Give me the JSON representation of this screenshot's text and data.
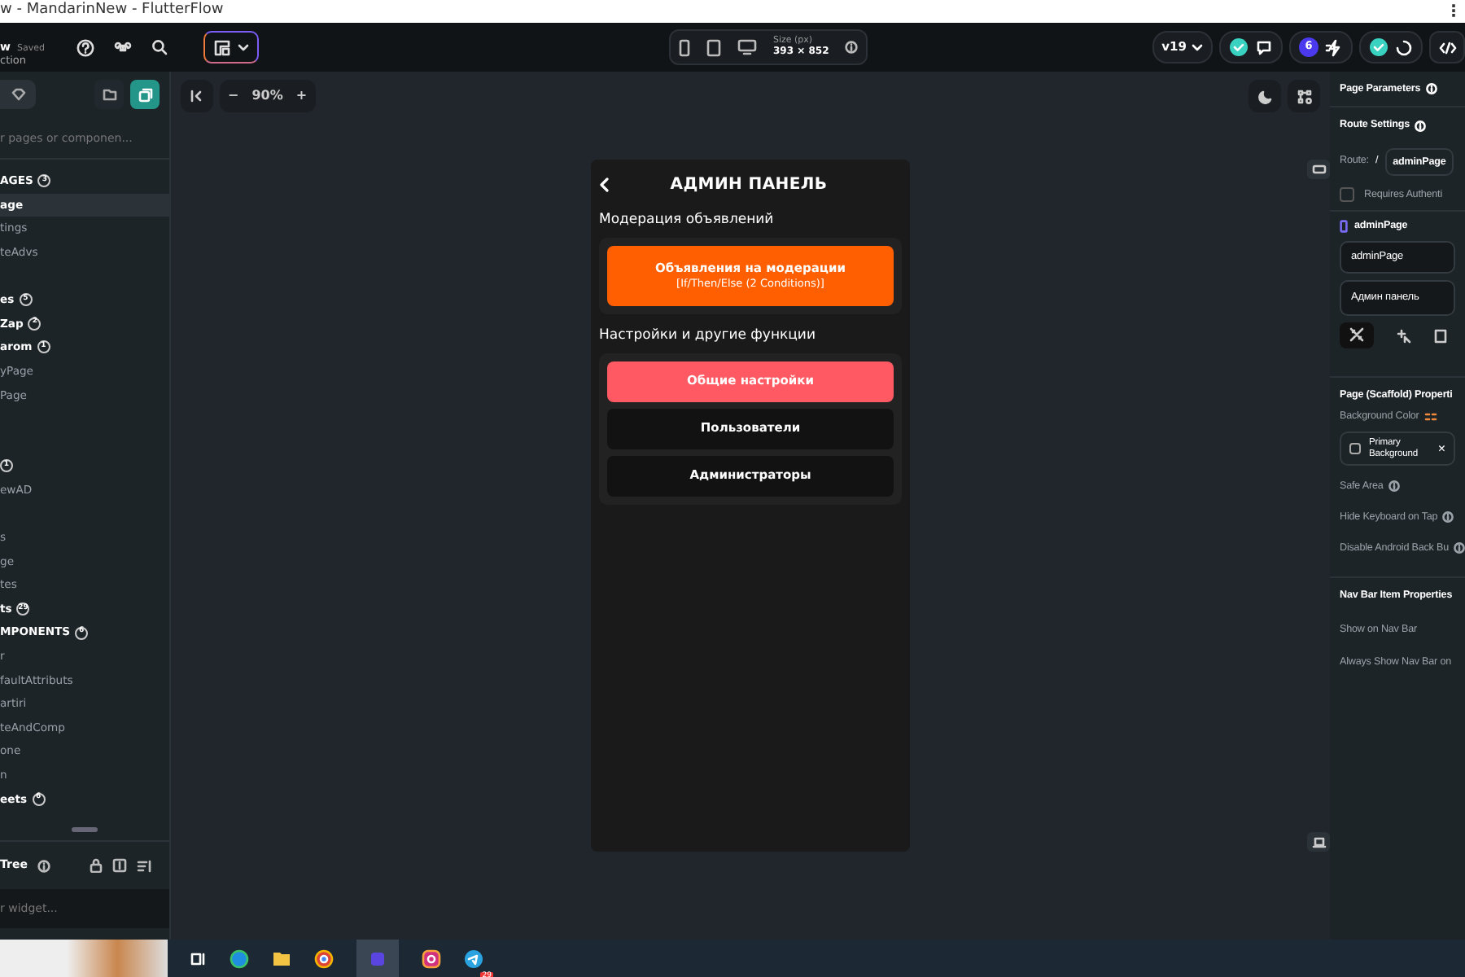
{
  "window": {
    "title": "w - MandarinNew - FlutterFlow",
    "menu": "⋮"
  },
  "toolbar": {
    "project_name": "w",
    "save_state": "Saved",
    "project_sub": "ction",
    "size_label": "Size (px)",
    "size_value": "393 × 852",
    "version": "v19",
    "notifications": "6"
  },
  "left_panel": {
    "search": {
      "placeholder": "r pages or componen..."
    },
    "items": [
      {
        "kind": "section",
        "label": "AGES",
        "count": "3"
      },
      {
        "kind": "page",
        "label": "age",
        "selected": true
      },
      {
        "kind": "page",
        "label": "tings",
        "selected": false
      },
      {
        "kind": "page",
        "label": "teAdvs",
        "selected": false
      },
      {
        "kind": "spacer"
      },
      {
        "kind": "folder",
        "label": "es",
        "count": "5"
      },
      {
        "kind": "folder",
        "label": "Zap",
        "count": "2"
      },
      {
        "kind": "folder",
        "label": "arom",
        "count": "1"
      },
      {
        "kind": "page",
        "label": "yPage",
        "selected": false
      },
      {
        "kind": "page",
        "label": "Page",
        "selected": false
      },
      {
        "kind": "spacer"
      },
      {
        "kind": "spacer"
      },
      {
        "kind": "folder",
        "count": "1"
      },
      {
        "kind": "page",
        "label": "ewAD",
        "selected": false
      },
      {
        "kind": "spacer"
      },
      {
        "kind": "page",
        "label": "s",
        "selected": false
      },
      {
        "kind": "page",
        "label": "ge",
        "selected": false
      },
      {
        "kind": "page",
        "label": "tes",
        "selected": false
      },
      {
        "kind": "folder",
        "label": "ts",
        "count": "29"
      },
      {
        "kind": "section",
        "label": "MPONENTS",
        "count": "6"
      },
      {
        "kind": "page",
        "label": "r",
        "selected": false
      },
      {
        "kind": "page",
        "label": "faultAttributs",
        "selected": false
      },
      {
        "kind": "page",
        "label": "artiri",
        "selected": false
      },
      {
        "kind": "page",
        "label": "teAndComp",
        "selected": false
      },
      {
        "kind": "page",
        "label": "one",
        "selected": false
      },
      {
        "kind": "page",
        "label": "n",
        "selected": false
      },
      {
        "kind": "folder",
        "label": "eets",
        "count": "6"
      }
    ],
    "tree_title": "Tree",
    "tree_search": {
      "placeholder": "r widget..."
    }
  },
  "canvas": {
    "zoom": "90%",
    "zoom_out": "−",
    "zoom_in": "+"
  },
  "phone": {
    "title": "АДМИН ПАНЕЛЬ",
    "sections": [
      {
        "heading": "Модерация объявлений",
        "buttons": [
          {
            "label": "Объявления на модерации",
            "sublabel": "[If/Then/Else (2 Conditions)]",
            "color": "#ff5f00"
          }
        ]
      },
      {
        "heading": "Настройки и другие функции",
        "buttons": [
          {
            "label": "Общие настройки",
            "color": "#ff5963"
          },
          {
            "label": "Пользователи",
            "color": "#121212"
          },
          {
            "label": "Администраторы",
            "color": "#121212"
          }
        ]
      }
    ]
  },
  "right_panel": {
    "page_parameters": "Page Parameters",
    "route_settings": "Route Settings",
    "route_label": "Route:",
    "route_slash": "/",
    "route_value": "adminPage",
    "requires_auth": {
      "label": "Requires Authenti",
      "checked": false
    },
    "page_name": "adminPage",
    "name_value": "adminPage",
    "title_value": "Админ панель",
    "scaffold_title": "Page (Scaffold) Properti",
    "background_color": "Background Color",
    "color_value": "Primary Background",
    "clear": "×",
    "props": [
      "Safe Area",
      "Hide Keyboard on Tap",
      "Disable Android Back Bu"
    ],
    "navbar_title": "Nav Bar Item Properties",
    "navbar_props": [
      "Show on Nav Bar",
      "Always Show Nav Bar on"
    ]
  },
  "taskbar": {
    "telegram_badge": "29"
  }
}
